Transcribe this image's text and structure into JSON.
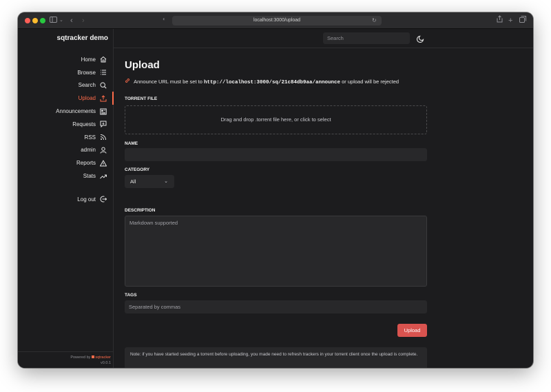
{
  "browser": {
    "url": "localhost:3000/upload"
  },
  "sidebar": {
    "brand": "sqtracker demo",
    "items": [
      {
        "label": "Home",
        "icon": "home-icon",
        "active": false
      },
      {
        "label": "Browse",
        "icon": "list-icon",
        "active": false
      },
      {
        "label": "Search",
        "icon": "search-icon",
        "active": false
      },
      {
        "label": "Upload",
        "icon": "upload-icon",
        "active": true
      },
      {
        "label": "Announcements",
        "icon": "newspaper-icon",
        "active": false
      },
      {
        "label": "Requests",
        "icon": "request-icon",
        "active": false
      },
      {
        "label": "RSS",
        "icon": "rss-icon",
        "active": false
      },
      {
        "label": "admin",
        "icon": "user-icon",
        "active": false
      },
      {
        "label": "Reports",
        "icon": "warning-icon",
        "active": false
      },
      {
        "label": "Stats",
        "icon": "trend-icon",
        "active": false
      }
    ],
    "logout_label": "Log out",
    "powered_by": "Powered by",
    "powered_brand": "sqtracker",
    "version": "v0.0.1"
  },
  "topbar": {
    "search_placeholder": "Search"
  },
  "main": {
    "title": "Upload",
    "announce_prefix": "Announce URL must be set to",
    "announce_url": "http://localhost:3000/sq/21c84db9aa/announce",
    "announce_suffix": "or upload will be rejected",
    "torrent_file_label": "TORRENT FILE",
    "dropzone_text": "Drag and drop .torrent file here, or click to select",
    "name_label": "NAME",
    "name_value": "",
    "category_label": "CATEGORY",
    "category_value": "All",
    "description_label": "DESCRIPTION",
    "description_placeholder": "Markdown supported",
    "tags_label": "TAGS",
    "tags_placeholder": "Separated by commas",
    "upload_button": "Upload",
    "note": "Note: if you have started seeding a torrent before uploading, you made need to refresh trackers in your torrent client once the upload is complete."
  },
  "colors": {
    "accent": "#ff6b4a",
    "button": "#d9534f",
    "background": "#1c1c1e",
    "input": "#28282a"
  }
}
